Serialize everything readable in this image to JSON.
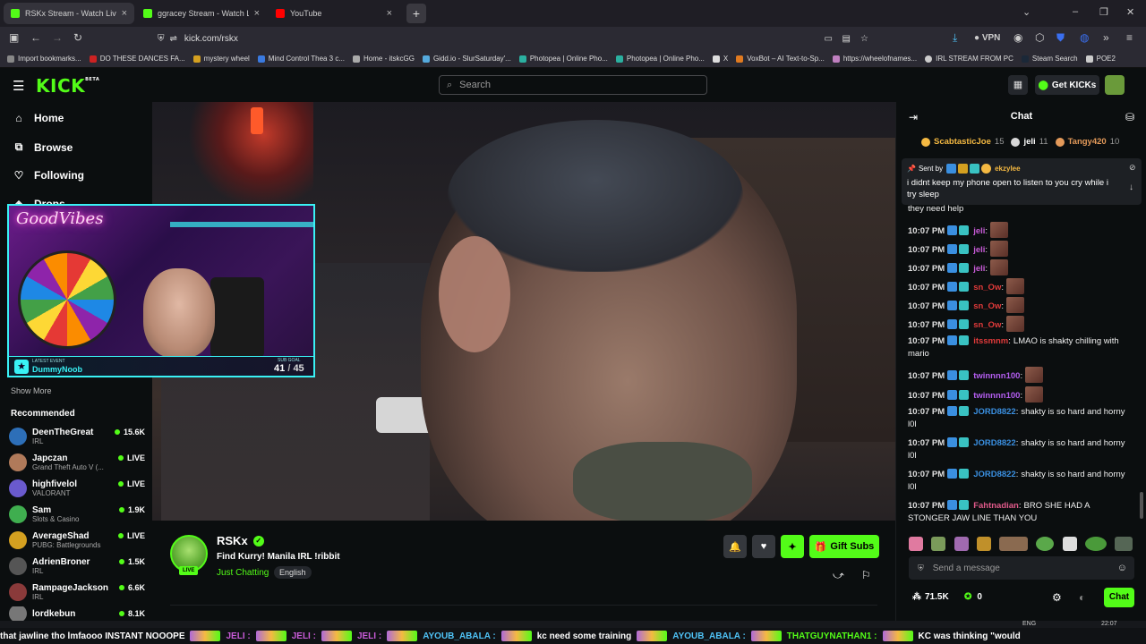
{
  "browser": {
    "tabs": [
      {
        "label": "RSKx Stream - Watch Live on Ki",
        "active": true,
        "color": "#53fc18"
      },
      {
        "label": "ggracey Stream - Watch Live on",
        "active": false,
        "color": "#53fc18"
      },
      {
        "label": "YouTube",
        "active": false,
        "color": "#ff0000"
      }
    ],
    "new_tab": "+",
    "url": "kick.com/rskx",
    "vpn": "VPN",
    "bookmarks": [
      "Import bookmarks...",
      "DO THESE DANCES FA...",
      "mystery wheel",
      "Mind Control Thea 3 c...",
      "Home - itskcGG",
      "Gidd.io - SlurSaturday'...",
      "Photopea | Online Pho...",
      "Photopea | Online Pho...",
      "X",
      "VoxBot – AI Text-to-Sp...",
      "https://wheelofnames...",
      "IRL STREAM FROM PC",
      "Steam Search",
      "POE2"
    ]
  },
  "kick": {
    "logo": "KICK",
    "logo_beta": "BETA",
    "search_placeholder": "Search",
    "get_kicks": "Get KICKs",
    "accent": "#53fc18"
  },
  "sidebar": {
    "nav": [
      {
        "label": "Home",
        "icon": "home-icon"
      },
      {
        "label": "Browse",
        "icon": "browse-icon"
      },
      {
        "label": "Following",
        "icon": "heart-icon"
      },
      {
        "label": "Drops",
        "icon": "drops-icon"
      }
    ],
    "show_more": "Show More",
    "recommended_title": "Recommended",
    "recommended": [
      {
        "name": "DeenTheGreat",
        "category": "IRL",
        "viewers": "15.6K",
        "color": "#2d6fb8"
      },
      {
        "name": "Japczan",
        "category": "Grand Theft Auto V (...",
        "viewers": "LIVE",
        "color": "#b07a5a"
      },
      {
        "name": "highfivelol",
        "category": "VALORANT",
        "viewers": "LIVE",
        "color": "#6a5acd"
      },
      {
        "name": "Sam",
        "category": "Slots & Casino",
        "viewers": "1.9K",
        "color": "#3fae4f"
      },
      {
        "name": "AverageShad",
        "category": "PUBG: Battlegrounds",
        "viewers": "LIVE",
        "color": "#d4a020"
      },
      {
        "name": "AdrienBroner",
        "category": "IRL",
        "viewers": "1.5K",
        "color": "#555555"
      },
      {
        "name": "RampageJackson",
        "category": "IRL",
        "viewers": "6.6K",
        "color": "#8a3a3a"
      },
      {
        "name": "lordkebun",
        "category": "",
        "viewers": "8.1K",
        "color": "#777777"
      }
    ]
  },
  "webcam": {
    "sign": "GoodVibes",
    "latest_event_label": "LATEST EVENT",
    "latest_event_name": "DummyNoob",
    "sub_goal_label": "SUB GOAL",
    "sub_goal_current": "41",
    "sub_goal_separator": "/",
    "sub_goal_target": "45"
  },
  "stream": {
    "channel": "RSKx",
    "title": "Find Kurry! Manila IRL !ribbit",
    "category": "Just Chatting",
    "language": "English",
    "live_badge": "LIVE",
    "gift_subs": "Gift Subs"
  },
  "chat": {
    "header": "Chat",
    "top_gifters": [
      {
        "name": "ScabtasticJoe",
        "count": "15",
        "color": "#f5b942"
      },
      {
        "name": "jeli",
        "count": "11",
        "color": "#d8d8d8"
      },
      {
        "name": "Tangy420",
        "count": "10",
        "color": "#e49a5a"
      }
    ],
    "pinned": {
      "sent_by": "Sent by",
      "user": "ekzylee",
      "message": "i didnt keep my phone open to listen to you cry while i try sleep"
    },
    "overflow_text": "they need help",
    "messages": [
      {
        "time": "10:07 PM",
        "user": "jeli",
        "sep": ":",
        "text": "",
        "color": "#c95bd8",
        "emote": true
      },
      {
        "time": "10:07 PM",
        "user": "jeli",
        "sep": ":",
        "text": "",
        "color": "#c95bd8",
        "emote": true
      },
      {
        "time": "10:07 PM",
        "user": "jeli",
        "sep": ":",
        "text": "",
        "color": "#c95bd8",
        "emote": true
      },
      {
        "time": "10:07 PM",
        "user": "sn_Ow",
        "sep": ":",
        "text": "",
        "color": "#e03a3a",
        "emote": true
      },
      {
        "time": "10:07 PM",
        "user": "sn_Ow",
        "sep": ":",
        "text": "",
        "color": "#e03a3a",
        "emote": true
      },
      {
        "time": "10:07 PM",
        "user": "sn_Ow",
        "sep": ":",
        "text": "",
        "color": "#e03a3a",
        "emote": true
      },
      {
        "time": "10:07 PM",
        "user": "itssmnm",
        "sep": ":",
        "text": "LMAO is shakty chilling with mario",
        "color": "#e03a3a",
        "emote": false
      },
      {
        "time": "10:07 PM",
        "user": "twinnnn100",
        "sep": ":",
        "text": "",
        "color": "#b45ef0",
        "emote": true
      },
      {
        "time": "10:07 PM",
        "user": "twinnnn100",
        "sep": ":",
        "text": "",
        "color": "#b45ef0",
        "emote": true
      },
      {
        "time": "10:07 PM",
        "user": "JORD8822",
        "sep": ":",
        "text": "shakty is so hard and horny l0l",
        "color": "#3a8fe0",
        "emote": false
      },
      {
        "time": "10:07 PM",
        "user": "JORD8822",
        "sep": ":",
        "text": "shakty is so hard and horny l0l",
        "color": "#3a8fe0",
        "emote": false
      },
      {
        "time": "10:07 PM",
        "user": "JORD8822",
        "sep": ":",
        "text": "shakty is so hard and horny l0l",
        "color": "#3a8fe0",
        "emote": false
      },
      {
        "time": "10:07 PM",
        "user": "Fahtnadian",
        "sep": ":",
        "text": "BRO SHE HAD A STONGER JAW LINE THAN YOU",
        "color": "#e05a8a",
        "emote": false
      }
    ],
    "input_placeholder": "Send a message",
    "kicks_count": "71.5K",
    "points_count": "0",
    "send_button": "Chat"
  },
  "ticker": {
    "segments": [
      {
        "text": "that jawline tho lmfaooo INSTANT NOOOPE",
        "color": "#ffffff"
      },
      {
        "text": "JELI :",
        "color": "#c95bd8"
      },
      {
        "text": "JELI :",
        "color": "#c95bd8"
      },
      {
        "text": "JELI :",
        "color": "#c95bd8"
      },
      {
        "text": "AYOUB_ABALA :",
        "color": "#4fc3f7"
      },
      {
        "text": "kc need some training",
        "color": "#ffffff"
      },
      {
        "text": "AYOUB_ABALA :",
        "color": "#4fc3f7"
      },
      {
        "text": "THATGUYNATHAN1 :",
        "color": "#53fc18"
      },
      {
        "text": "KC was thinking \"would",
        "color": "#ffffff"
      }
    ]
  },
  "taskbar": {
    "lang": "ENG",
    "time": "22:07"
  }
}
